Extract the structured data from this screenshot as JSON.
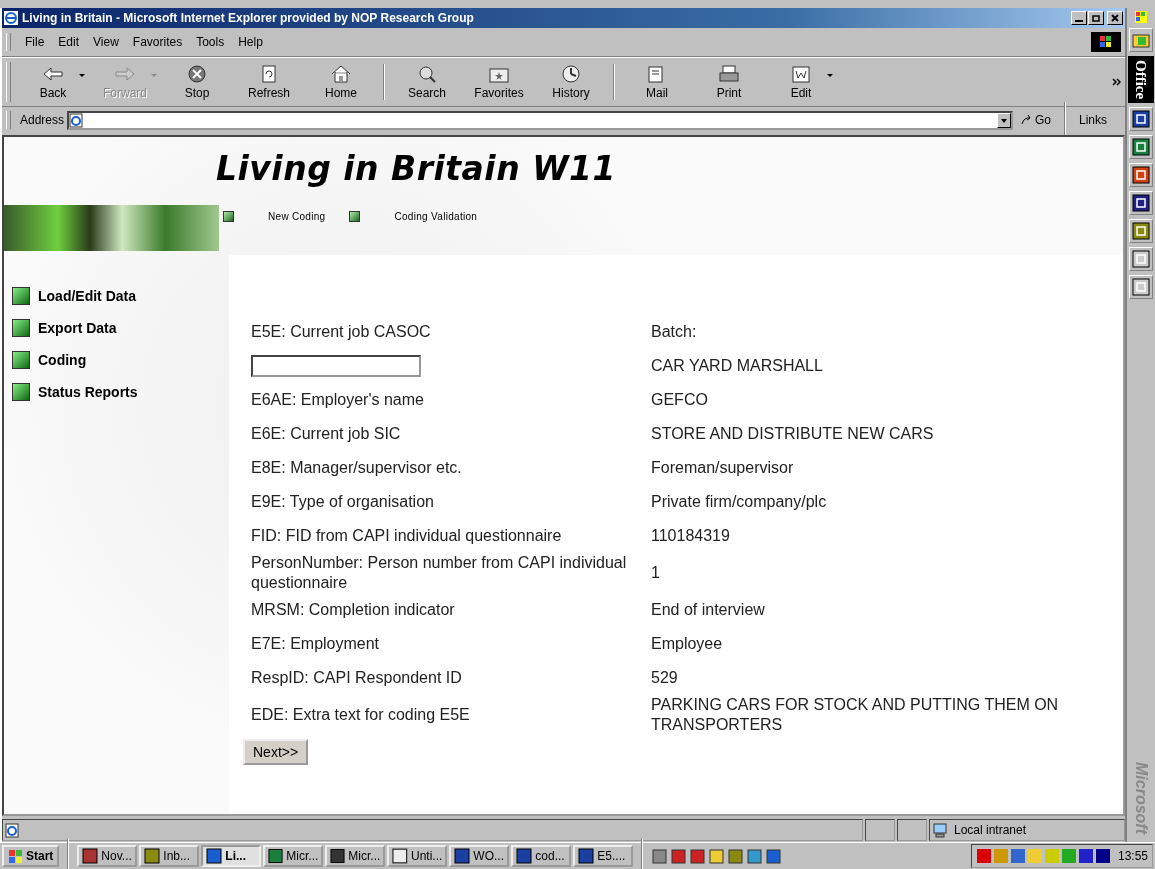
{
  "window": {
    "title": "Living in Britain - Microsoft Internet Explorer provided by NOP Research Group"
  },
  "menu": [
    "File",
    "Edit",
    "View",
    "Favorites",
    "Tools",
    "Help"
  ],
  "toolbar": [
    {
      "label": "Back",
      "disabled": false,
      "dropdown": true
    },
    {
      "label": "Forward",
      "disabled": true,
      "dropdown": true
    },
    {
      "label": "Stop",
      "disabled": false,
      "dropdown": false
    },
    {
      "label": "Refresh",
      "disabled": false,
      "dropdown": false
    },
    {
      "label": "Home",
      "disabled": false,
      "dropdown": false
    },
    {
      "label": "Search",
      "disabled": false,
      "dropdown": false
    },
    {
      "label": "Favorites",
      "disabled": false,
      "dropdown": false
    },
    {
      "label": "History",
      "disabled": false,
      "dropdown": false
    },
    {
      "label": "Mail",
      "disabled": false,
      "dropdown": false
    },
    {
      "label": "Print",
      "disabled": false,
      "dropdown": false
    },
    {
      "label": "Edit",
      "disabled": false,
      "dropdown": true
    }
  ],
  "address": {
    "label": "Address",
    "go": "Go",
    "links": "Links"
  },
  "page": {
    "title": "Living in Britain W11",
    "nav": [
      "New Coding",
      "Coding Validation"
    ],
    "sidebar": [
      "Load/Edit Data",
      "Export Data",
      "Coding",
      "Status Reports"
    ],
    "rows": [
      {
        "kind": "text",
        "label": "E5E: Current job CASOC",
        "value": "Batch:"
      },
      {
        "kind": "input",
        "label": "",
        "value": "CAR YARD MARSHALL"
      },
      {
        "kind": "text",
        "label": "E6AE: Employer's name",
        "value": "GEFCO"
      },
      {
        "kind": "text",
        "label": "E6E: Current job SIC",
        "value": "STORE AND DISTRIBUTE NEW CARS"
      },
      {
        "kind": "text",
        "label": "E8E: Manager/supervisor etc.",
        "value": "Foreman/supervisor"
      },
      {
        "kind": "text",
        "label": "E9E: Type of organisation",
        "value": "Private firm/company/plc"
      },
      {
        "kind": "text",
        "label": "FID: FID from CAPI individual questionnaire",
        "value": "110184319"
      },
      {
        "kind": "text",
        "label": "PersonNumber: Person number from CAPI individual questionnaire",
        "value": "1"
      },
      {
        "kind": "text",
        "label": "MRSM: Completion indicator",
        "value": "End of interview"
      },
      {
        "kind": "text",
        "label": "E7E: Employment",
        "value": "Employee"
      },
      {
        "kind": "text",
        "label": "RespID: CAPI Respondent ID",
        "value": "529"
      },
      {
        "kind": "text",
        "label": "EDE: Extra text for coding E5E",
        "value": "PARKING CARS FOR STOCK AND PUTTING THEM ON TRANSPORTERS"
      }
    ],
    "next": "Next>>"
  },
  "status_bar": {
    "zone": "Local intranet"
  },
  "taskbar": {
    "start": "Start",
    "tasks": [
      {
        "label": "Nov...",
        "selected": false
      },
      {
        "label": "Inb...",
        "selected": false
      },
      {
        "label": "Li...",
        "selected": true
      },
      {
        "label": "Micr...",
        "selected": false
      },
      {
        "label": "Micr...",
        "selected": false
      },
      {
        "label": "Unti...",
        "selected": false
      },
      {
        "label": "WO...",
        "selected": false
      },
      {
        "label": "cod...",
        "selected": false
      },
      {
        "label": "E5....",
        "selected": false
      }
    ],
    "clock": "13:55"
  },
  "office_bar": {
    "title": "Office",
    "brand": "Microsoft"
  }
}
